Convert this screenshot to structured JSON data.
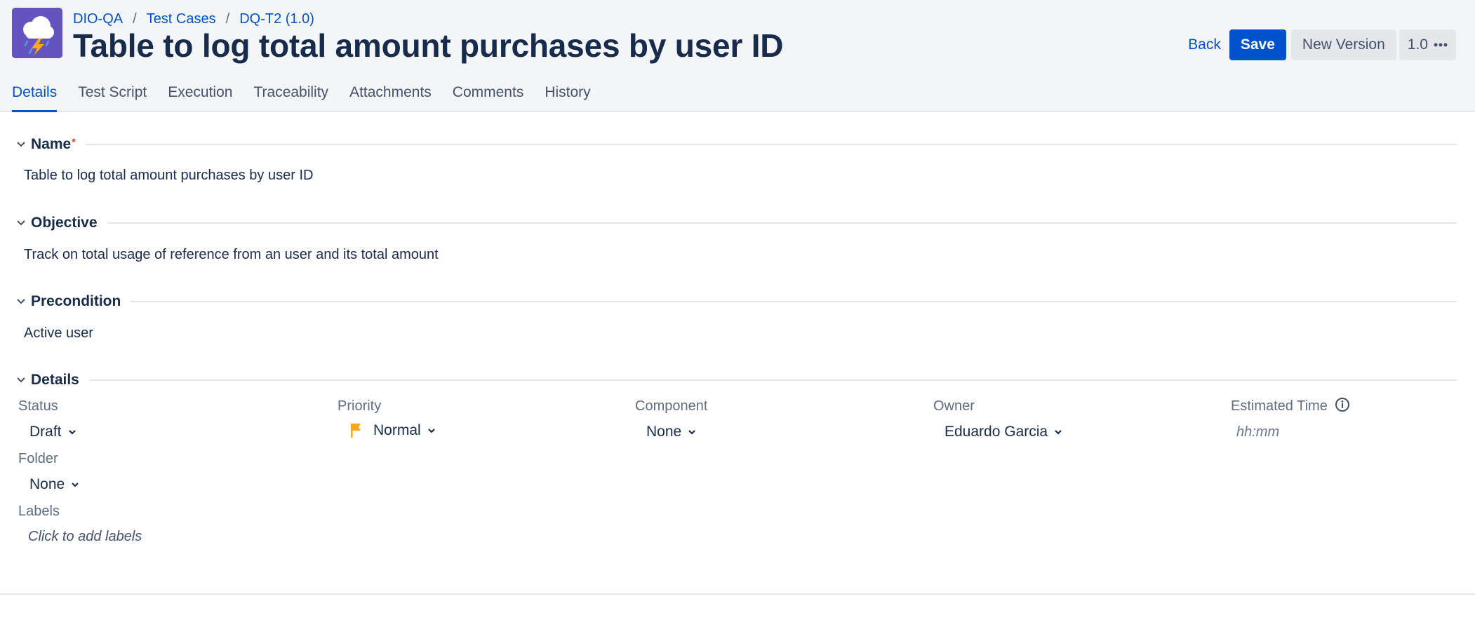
{
  "breadcrumb": {
    "project": "DIO-QA",
    "section": "Test Cases",
    "item": "DQ-T2 (1.0)",
    "separator": "/"
  },
  "title": "Table to log total amount purchases by user ID",
  "actions": {
    "back": "Back",
    "save": "Save",
    "new_version": "New Version",
    "version": "1.0"
  },
  "tabs": [
    {
      "label": "Details",
      "active": true
    },
    {
      "label": "Test Script"
    },
    {
      "label": "Execution"
    },
    {
      "label": "Traceability"
    },
    {
      "label": "Attachments"
    },
    {
      "label": "Comments"
    },
    {
      "label": "History"
    }
  ],
  "sections": {
    "name": {
      "title": "Name",
      "required_mark": "*",
      "value": "Table to log total amount purchases by user ID"
    },
    "objective": {
      "title": "Objective",
      "value": "Track on total usage of reference from an user and its total amount"
    },
    "precondition": {
      "title": "Precondition",
      "value": "Active user"
    },
    "details": {
      "title": "Details"
    }
  },
  "details": {
    "status": {
      "label": "Status",
      "value": "Draft"
    },
    "priority": {
      "label": "Priority",
      "value": "Normal",
      "flag_color": "#f5a623"
    },
    "component": {
      "label": "Component",
      "value": "None"
    },
    "owner": {
      "label": "Owner",
      "value": "Eduardo Garcia"
    },
    "estimated_time": {
      "label": "Estimated Time",
      "placeholder": "hh:mm"
    },
    "folder": {
      "label": "Folder",
      "value": "None"
    },
    "labels": {
      "label": "Labels",
      "placeholder": "Click to add labels"
    }
  },
  "colors": {
    "accent": "#0052cc",
    "avatar": "#6554c0",
    "header_bg": "#f4f5f7"
  }
}
